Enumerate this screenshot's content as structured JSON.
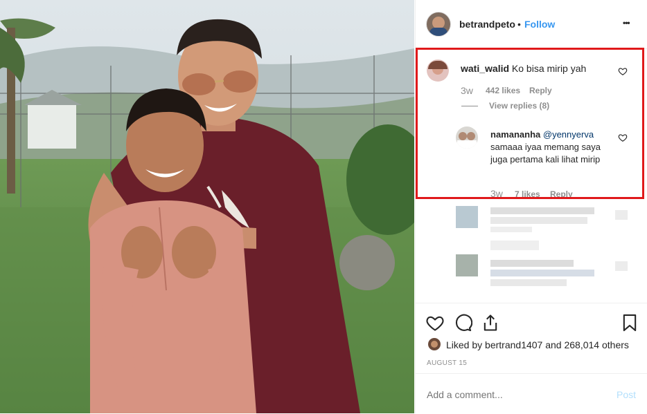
{
  "post": {
    "author": "betrandpeto",
    "follow_sep": "•",
    "follow_label": "Follow",
    "more_glyph": "•••"
  },
  "comments": [
    {
      "user": "wati_walid",
      "text": "Ko bisa mirip yah",
      "time": "3w",
      "likes": "442 likes",
      "reply": "Reply",
      "view_replies": "View replies (8)"
    }
  ],
  "reply": {
    "user": "namananha",
    "mention": "@yennyerva",
    "text": "samaaa iyaa memang saya juga pertama kali lihat mirip",
    "time": "3w",
    "likes": "7 likes",
    "reply": "Reply"
  },
  "likes": {
    "prefix": "Liked by",
    "user": "bertrand1407",
    "middle": "and",
    "count": "268,014 others"
  },
  "date": "AUGUST 15",
  "composer": {
    "placeholder": "Add a comment...",
    "post_label": "Post"
  },
  "icons": {
    "like": "heart-icon",
    "comment": "comment-icon",
    "share": "share-icon",
    "save": "bookmark-icon",
    "more": "more-options-icon"
  },
  "colors": {
    "link": "#3897f0",
    "highlight_box": "#e0191b",
    "muted": "#8e8e8e",
    "post_disabled": "#b2dffc"
  }
}
